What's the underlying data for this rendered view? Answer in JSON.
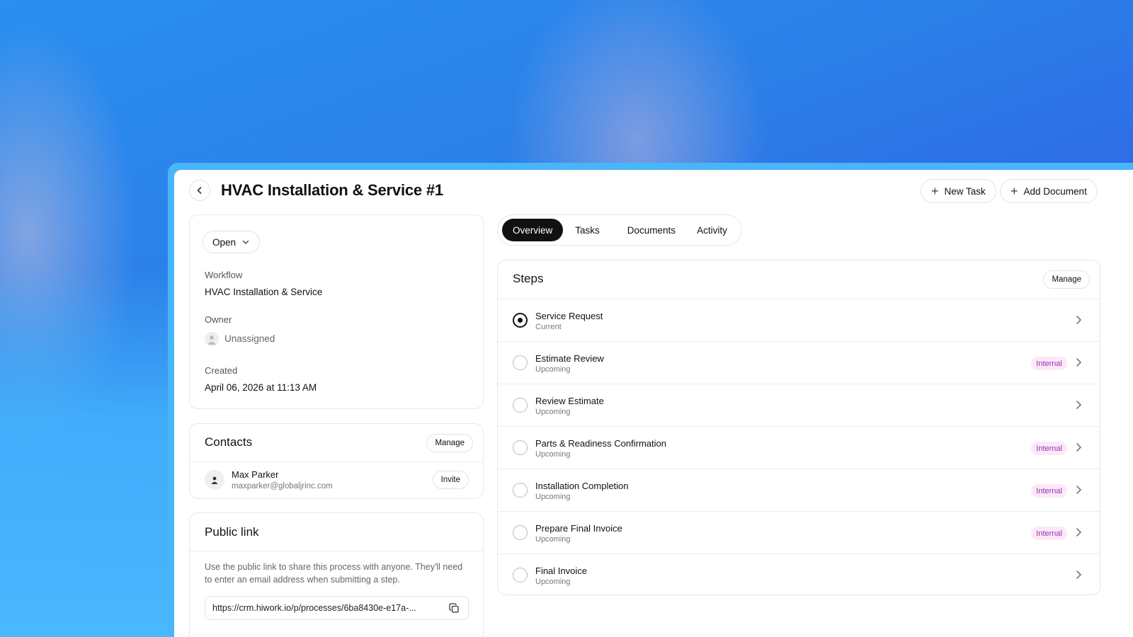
{
  "page": {
    "title": "HVAC Installation & Service #1",
    "actions": {
      "new_task": "New Task",
      "add_document": "Add Document"
    }
  },
  "details": {
    "status": "Open",
    "workflow_label": "Workflow",
    "workflow_value": "HVAC Installation & Service",
    "owner_label": "Owner",
    "owner_value": "Unassigned",
    "created_label": "Created",
    "created_value": "April 06, 2026 at 11:13 AM"
  },
  "contacts": {
    "title": "Contacts",
    "manage_label": "Manage",
    "items": [
      {
        "name": "Max Parker",
        "email": "maxparker@globaljrinc.com",
        "action": "Invite"
      }
    ]
  },
  "public_link": {
    "title": "Public link",
    "description": "Use the public link to share this process with anyone. They'll need to enter an email address when submitting a step.",
    "url": "https://crm.hiwork.io/p/processes/6ba8430e-e17a-..."
  },
  "tabs": [
    {
      "label": "Overview",
      "active": true
    },
    {
      "label": "Tasks",
      "active": false
    },
    {
      "label": "Documents",
      "active": false
    },
    {
      "label": "Activity",
      "active": false
    }
  ],
  "steps": {
    "title": "Steps",
    "manage_label": "Manage",
    "items": [
      {
        "name": "Service Request",
        "status": "Current",
        "badge": ""
      },
      {
        "name": "Estimate Review",
        "status": "Upcoming",
        "badge": "Internal"
      },
      {
        "name": "Review Estimate",
        "status": "Upcoming",
        "badge": ""
      },
      {
        "name": "Parts & Readiness Confirmation",
        "status": "Upcoming",
        "badge": "Internal"
      },
      {
        "name": "Installation Completion",
        "status": "Upcoming",
        "badge": "Internal"
      },
      {
        "name": "Prepare Final Invoice",
        "status": "Upcoming",
        "badge": "Internal"
      },
      {
        "name": "Final Invoice",
        "status": "Upcoming",
        "badge": ""
      }
    ]
  },
  "colors": {
    "background_blue": "#2b7fe8",
    "frame_blue": "#48b6f8",
    "active_tab": "#111111",
    "badge_bg": "#fbe9f8",
    "badge_text": "#9b2fb8"
  },
  "icons": {
    "back": "chevron-left-icon",
    "add": "plus-icon",
    "status_dropdown": "chevron-down-icon",
    "owner": "user-icon",
    "copy": "copy-icon",
    "step_open": "chevron-right-icon"
  }
}
